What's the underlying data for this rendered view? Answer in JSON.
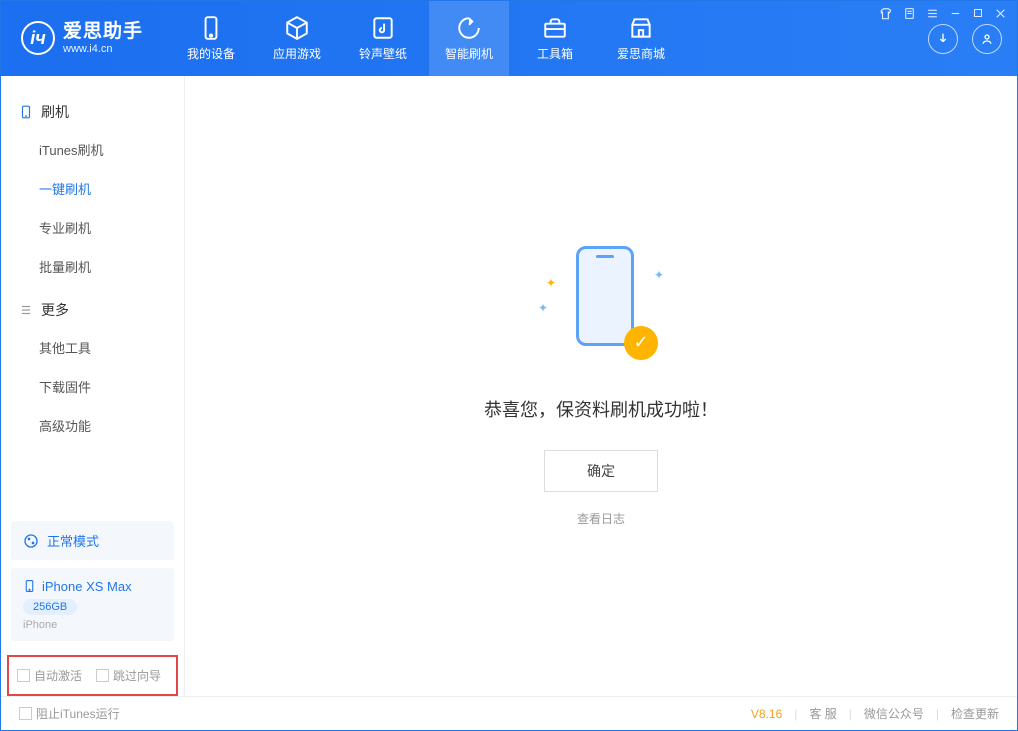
{
  "app": {
    "title": "爱思助手",
    "url": "www.i4.cn"
  },
  "nav": [
    {
      "label": "我的设备",
      "icon": "device"
    },
    {
      "label": "应用游戏",
      "icon": "cube"
    },
    {
      "label": "铃声壁纸",
      "icon": "music"
    },
    {
      "label": "智能刷机",
      "icon": "refresh",
      "active": true
    },
    {
      "label": "工具箱",
      "icon": "toolbox"
    },
    {
      "label": "爱思商城",
      "icon": "shop"
    }
  ],
  "sidebar": {
    "flash_head": "刷机",
    "flash_items": [
      "iTunes刷机",
      "一键刷机",
      "专业刷机",
      "批量刷机"
    ],
    "flash_active": 1,
    "more_head": "更多",
    "more_items": [
      "其他工具",
      "下载固件",
      "高级功能"
    ]
  },
  "status": {
    "label": "正常模式"
  },
  "device": {
    "name": "iPhone XS Max",
    "storage": "256GB",
    "type": "iPhone"
  },
  "options": {
    "auto_activate": "自动激活",
    "skip_guide": "跳过向导"
  },
  "main": {
    "message": "恭喜您，保资料刷机成功啦！",
    "ok": "确定",
    "log": "查看日志"
  },
  "footer": {
    "block_itunes": "阻止iTunes运行",
    "version": "V8.16",
    "service": "客 服",
    "wechat": "微信公众号",
    "update": "检查更新"
  }
}
